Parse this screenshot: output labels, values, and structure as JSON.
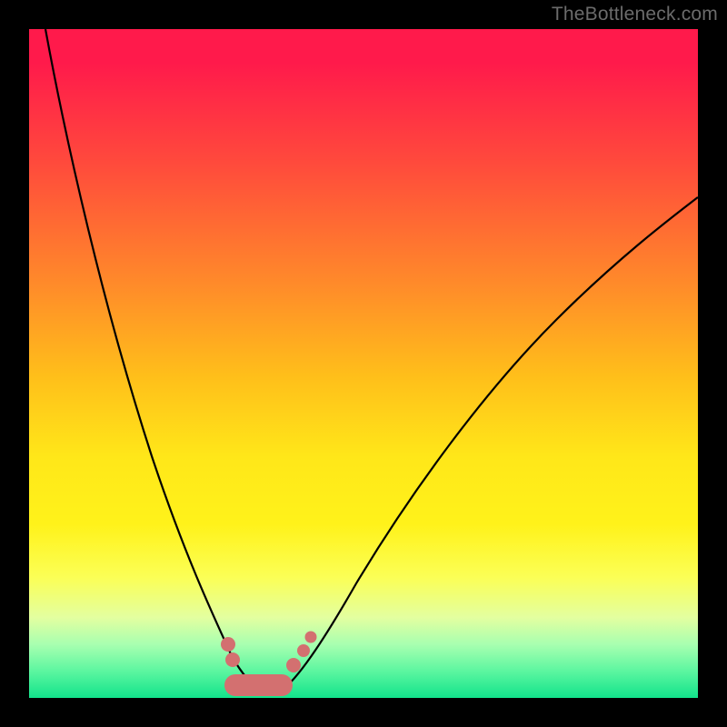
{
  "watermark": "TheBottleneck.com",
  "colors": {
    "background": "#000000",
    "marker": "#d37070",
    "curve": "#000000",
    "gradient_top": "#ff1a4b",
    "gradient_bottom": "#12e38b"
  },
  "chart_data": {
    "type": "line",
    "title": "",
    "xlabel": "",
    "ylabel": "",
    "xlim": [
      0,
      100
    ],
    "ylim": [
      0,
      100
    ],
    "grid": false,
    "legend": false,
    "note": "V-shaped bottleneck curve with a minimum near x≈34 and a pink marker bar at the bottom of the valley. Axis values estimated from pixel positions (no tick labels in source).",
    "x": [
      0,
      2,
      5,
      8,
      11,
      14,
      17,
      20,
      23,
      26,
      28,
      30,
      33,
      34,
      36,
      38,
      40,
      44,
      50,
      57,
      65,
      75,
      85,
      95,
      100
    ],
    "y": [
      100,
      96,
      89,
      81,
      73,
      65,
      56,
      47,
      38,
      29,
      22,
      15,
      6,
      2,
      2,
      8,
      13,
      22,
      34,
      45,
      55,
      64,
      71,
      77,
      79
    ],
    "markers": {
      "type": "bar_segment",
      "x_range": [
        28.5,
        38.5
      ],
      "y": 3.5,
      "dots": [
        {
          "x": 29.5,
          "y": 17
        },
        {
          "x": 30.5,
          "y": 13
        },
        {
          "x": 38.5,
          "y": 12
        },
        {
          "x": 40.0,
          "y": 16
        },
        {
          "x": 41.0,
          "y": 19
        }
      ]
    }
  }
}
